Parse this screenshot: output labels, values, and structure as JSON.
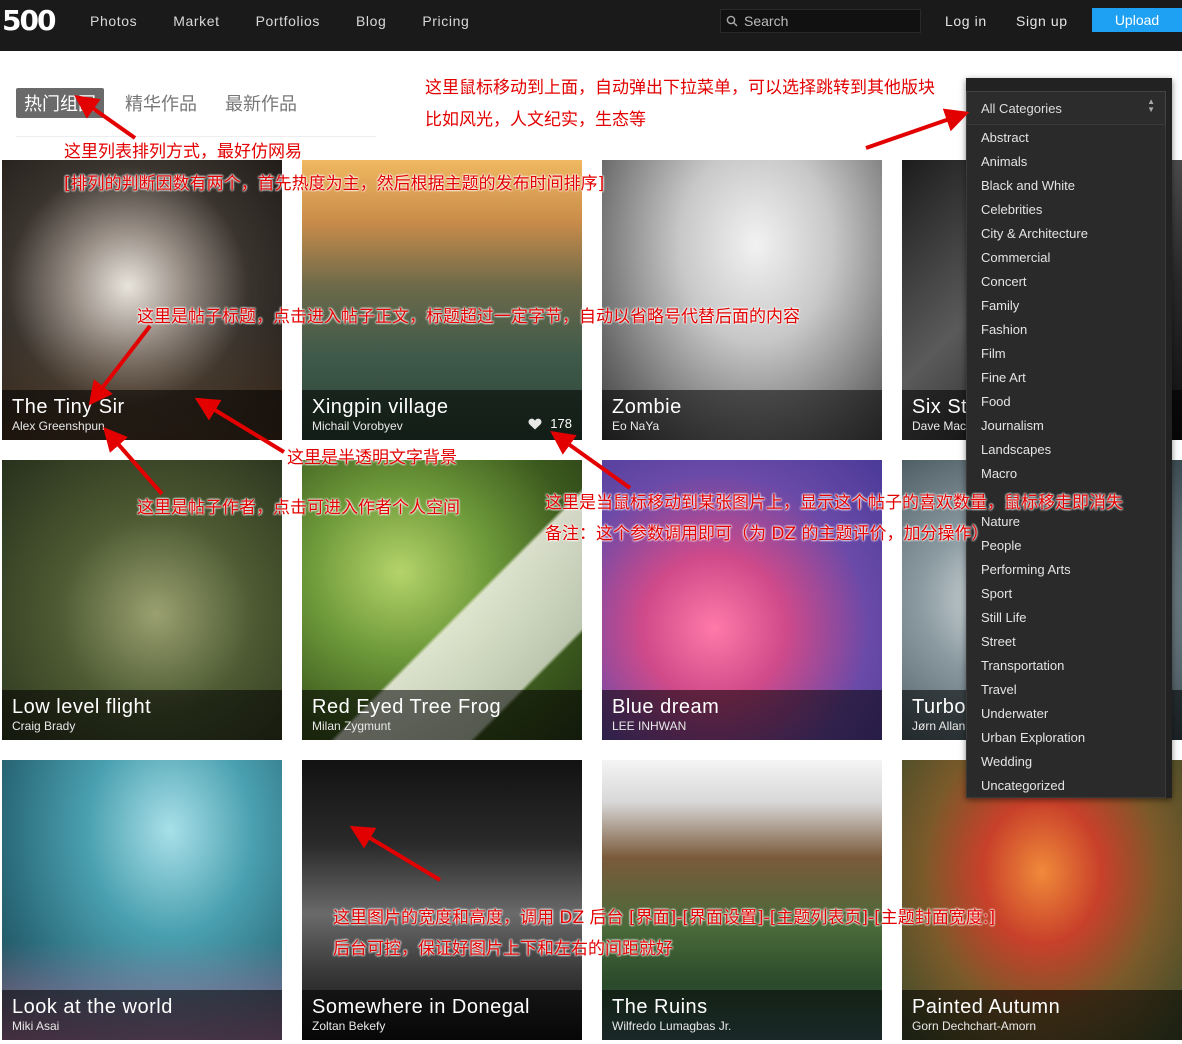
{
  "header": {
    "logo": "500",
    "nav": [
      "Photos",
      "Market",
      "Portfolios",
      "Blog",
      "Pricing"
    ],
    "search_placeholder": "Search",
    "login": "Log in",
    "signup": "Sign up",
    "upload": "Upload"
  },
  "tabs": [
    "热门组图",
    "精华作品",
    "最新作品"
  ],
  "category_select": {
    "selected": "All Categories",
    "options": [
      "Abstract",
      "Animals",
      "Black and White",
      "Celebrities",
      "City & Architecture",
      "Commercial",
      "Concert",
      "Family",
      "Fashion",
      "Film",
      "Fine Art",
      "Food",
      "Journalism",
      "Landscapes",
      "Macro",
      "Nature",
      "People",
      "Performing Arts",
      "Sport",
      "Still Life",
      "Street",
      "Transportation",
      "Travel",
      "Underwater",
      "Urban Exploration",
      "Wedding",
      "Uncategorized"
    ]
  },
  "photos": [
    {
      "title": "The Tiny Sir",
      "author": "Alex Greenshpun"
    },
    {
      "title": "Xingpin village",
      "author": "Michail Vorobyev",
      "likes": "178"
    },
    {
      "title": "Zombie",
      "author": "Eo NaYa"
    },
    {
      "title": "Six St",
      "author": "Dave Mac"
    },
    {
      "title": "Low level flight",
      "author": "Craig Brady"
    },
    {
      "title": "Red Eyed Tree Frog",
      "author": "Milan Zygmunt"
    },
    {
      "title": "Blue dream",
      "author": "LEE INHWAN"
    },
    {
      "title": "Turbo",
      "author": "Jørn Allan"
    },
    {
      "title": "Look at the world",
      "author": "Miki Asai"
    },
    {
      "title": "Somewhere in Donegal",
      "author": "Zoltan Bekefy"
    },
    {
      "title": "The Ruins",
      "author": "Wilfredo Lumagbas Jr."
    },
    {
      "title": "Painted Autumn",
      "author": "Gorn Dechchart-Amorn"
    }
  ],
  "annotations": {
    "dropdown_1": "这里鼠标移动到上面，自动弹出下拉菜单，可以选择跳转到其他版块",
    "dropdown_2": "比如风光，人文纪实，生态等",
    "sort_1": "这里列表排列方式，最好仿网易",
    "sort_2": "[排列的判断因数有两个，首先热度为主，然后根据主题的发布时间排序]",
    "title_note": "这里是帖子标题，点击进入帖子正文，标题超过一定字节，自动以省略号代替后面的内容",
    "bg_note": "这里是半透明文字背景",
    "author_note": "这里是帖子作者，点击可进入作者个人空间",
    "likes_1": "这里是当鼠标移动到某张图片上，显示这个帖子的喜欢数量，鼠标移走即消失",
    "likes_2": "备注：这个参数调用即可（为 DZ 的主题评价，加分操作）",
    "size_1": "这里图片的宽度和高度，调用 DZ 后台 [界面]-[界面设置]-[主题列表页]-[主题封面宽度:]",
    "size_2": "后台可控，保证好图片上下和左右的间距就好"
  },
  "colors": {
    "topbar": "#1a1a1a",
    "upload": "#1ea1f2",
    "annotation": "#e30000"
  }
}
